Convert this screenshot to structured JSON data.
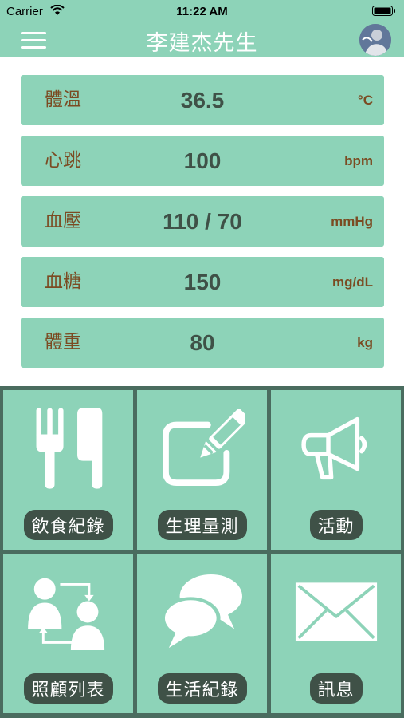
{
  "status_bar": {
    "carrier": "Carrier",
    "time": "11:22 AM"
  },
  "header": {
    "title": "李建杰先生"
  },
  "vitals": [
    {
      "label": "體溫",
      "value": "36.5",
      "unit": "°C"
    },
    {
      "label": "心跳",
      "value": "100",
      "unit": "bpm"
    },
    {
      "label": "血壓",
      "value": "110 / 70",
      "unit": "mmHg"
    },
    {
      "label": "血糖",
      "value": "150",
      "unit": "mg/dL"
    },
    {
      "label": "體重",
      "value": "80",
      "unit": "kg"
    }
  ],
  "grid": [
    {
      "label": "飲食紀錄",
      "icon": "utensils-icon"
    },
    {
      "label": "生理量測",
      "icon": "edit-icon"
    },
    {
      "label": "活動",
      "icon": "megaphone-icon"
    },
    {
      "label": "照顧列表",
      "icon": "users-exchange-icon"
    },
    {
      "label": "生活紀錄",
      "icon": "chat-bubbles-icon"
    },
    {
      "label": "訊息",
      "icon": "envelope-icon"
    }
  ],
  "colors": {
    "accent": "#8dd3b8",
    "grid_bg": "#4a6c5f",
    "label_text": "#7b4b22",
    "value_text": "#3f5147"
  }
}
